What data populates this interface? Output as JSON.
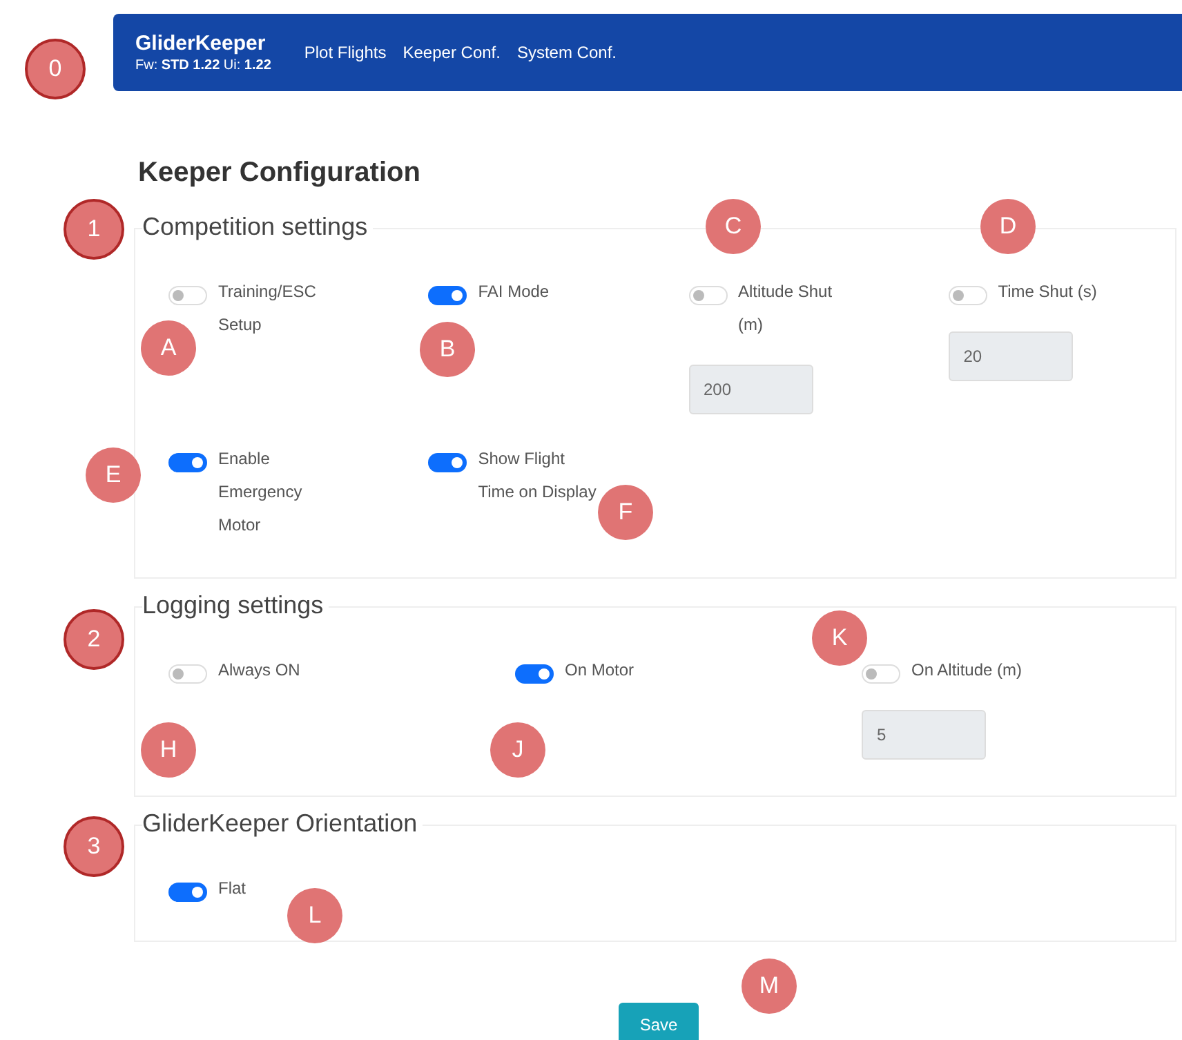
{
  "nav": {
    "brand": "GliderKeeper",
    "version": "Fw: **STD 1.22** Ui: **1.22**",
    "links": [
      "Plot Flights",
      "Keeper Conf.",
      "System Conf."
    ]
  },
  "heading": "Keeper Configuration",
  "sections": [
    {
      "legend": "Competition settings",
      "rows": [
        [
          {
            "label": "Training/ESC Setup",
            "on": false
          },
          {
            "label": "FAI Mode",
            "on": true
          },
          {
            "label": "Altitude Shut (m)",
            "on": false,
            "field": {
              "value": "200",
              "disabled": true
            }
          },
          {
            "label": "Time Shut (s)",
            "on": false,
            "field": {
              "value": "20",
              "disabled": true
            }
          }
        ],
        [
          {
            "label": "Enable Emergency Motor",
            "on": true
          },
          {
            "label": "Show Flight Time on Display",
            "on": true
          }
        ]
      ]
    },
    {
      "legend": "Logging settings",
      "rows": [
        [
          {
            "label": "Always ON",
            "on": false
          },
          {
            "label": "On Motor",
            "on": true
          },
          {
            "label": "On Altitude (m)",
            "on": false,
            "field": {
              "value": "5",
              "disabled": true
            }
          }
        ]
      ]
    },
    {
      "legend": "GliderKeeper Orientation",
      "rows": [
        [
          {
            "label": "Flat",
            "on": true
          }
        ]
      ]
    }
  ],
  "save": "Save",
  "markers": [
    {
      "label": "0",
      "bordered": true
    },
    {
      "label": "1",
      "bordered": true
    },
    {
      "label": "2",
      "bordered": true
    },
    {
      "label": "3",
      "bordered": true
    },
    {
      "label": "A",
      "bordered": false
    },
    {
      "label": "B",
      "bordered": false
    },
    {
      "label": "C",
      "bordered": false
    },
    {
      "label": "D",
      "bordered": false
    },
    {
      "label": "E",
      "bordered": false
    },
    {
      "label": "F",
      "bordered": false
    },
    {
      "label": "H",
      "bordered": false
    },
    {
      "label": "J",
      "bordered": false
    },
    {
      "label": "K",
      "bordered": false
    },
    {
      "label": "L",
      "bordered": false
    },
    {
      "label": "M",
      "bordered": false
    }
  ]
}
